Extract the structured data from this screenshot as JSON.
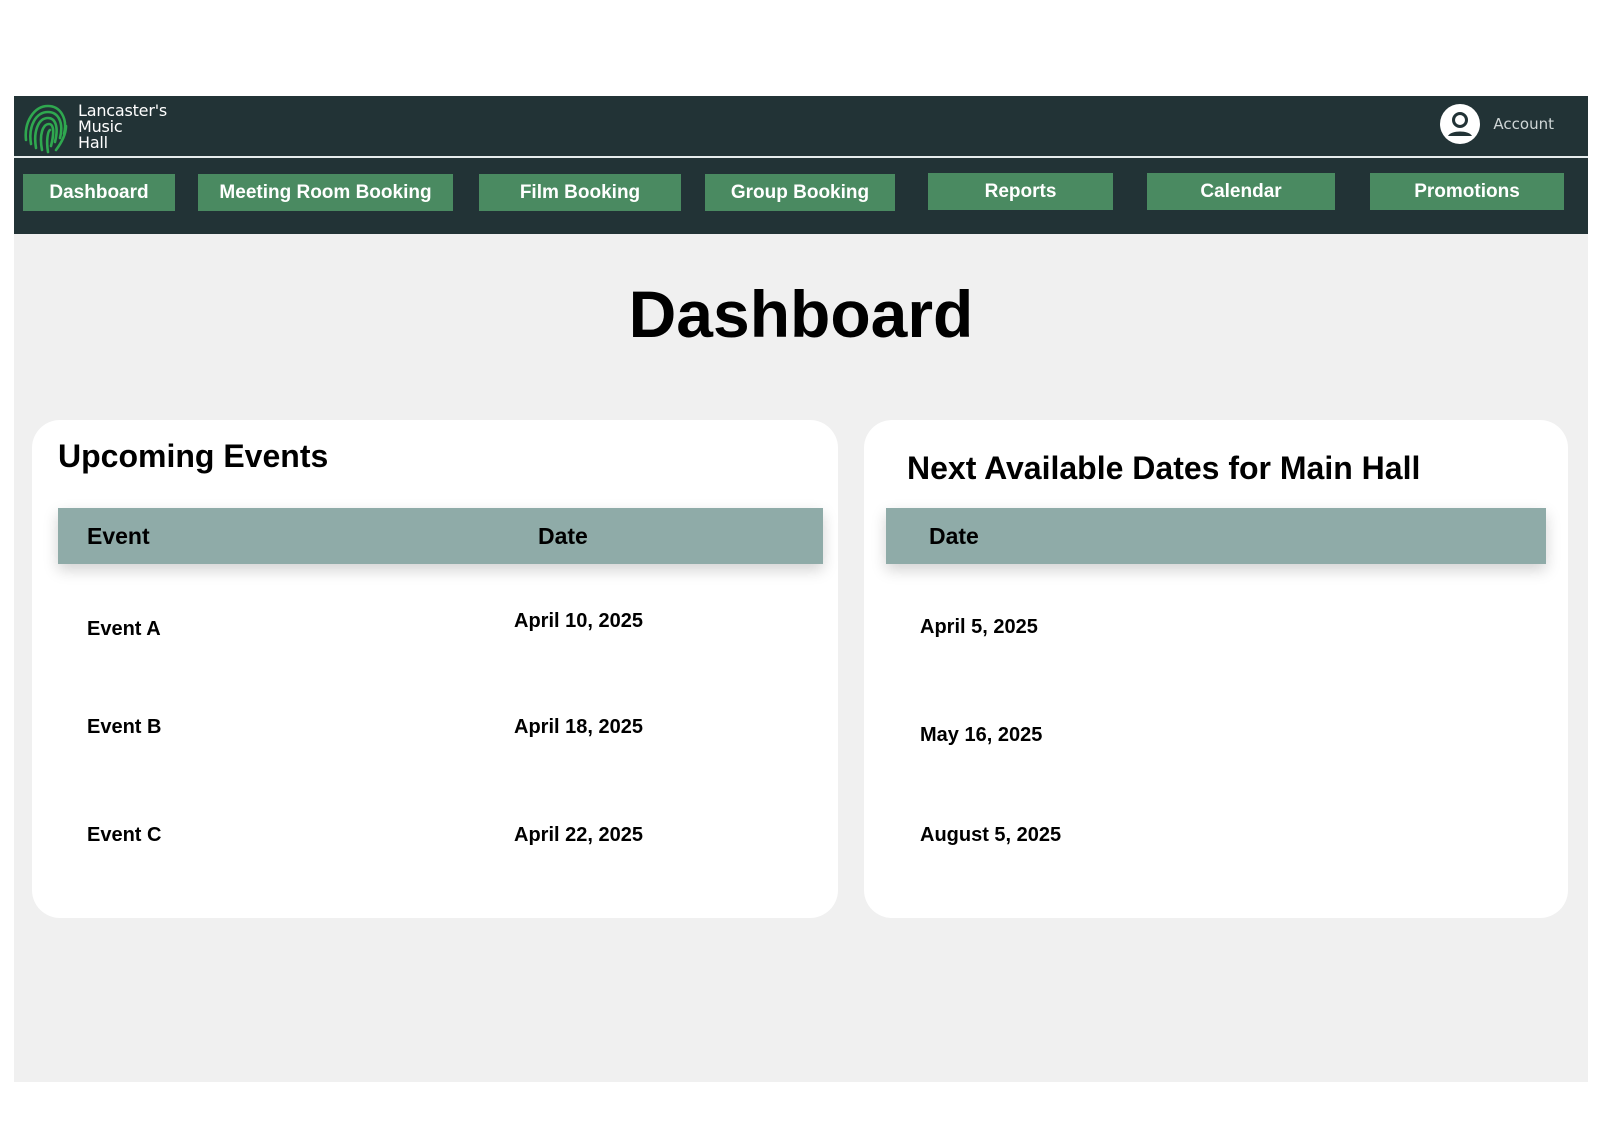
{
  "header": {
    "brand_line1": "Lancaster's",
    "brand_line2": "Music",
    "brand_line3": "Hall",
    "account_label": "Account",
    "brand_color": "#2fa84f"
  },
  "nav": {
    "items": [
      {
        "label": "Dashboard"
      },
      {
        "label": "Meeting Room Booking"
      },
      {
        "label": "Film Booking"
      },
      {
        "label": "Group Booking"
      },
      {
        "label": "Reports"
      },
      {
        "label": "Calendar"
      },
      {
        "label": "Promotions"
      }
    ]
  },
  "page": {
    "title": "Dashboard"
  },
  "upcoming": {
    "title": "Upcoming Events",
    "col_event": "Event",
    "col_date": "Date",
    "rows": [
      {
        "event": "Event A",
        "date": "April 10, 2025"
      },
      {
        "event": "Event B",
        "date": "April 18, 2025"
      },
      {
        "event": "Event C",
        "date": "April 22, 2025"
      }
    ]
  },
  "available": {
    "title": "Next Available Dates for Main Hall",
    "col_date": "Date",
    "rows": [
      {
        "date": "April 5, 2025"
      },
      {
        "date": "May 16, 2025"
      },
      {
        "date": "August 5, 2025"
      }
    ]
  }
}
